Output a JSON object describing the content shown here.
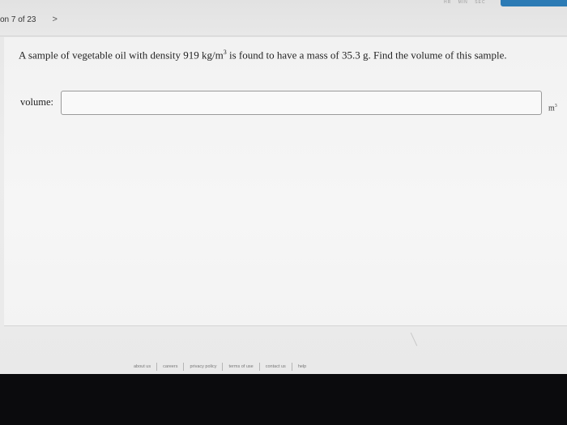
{
  "header": {
    "question_nav": "on 7 of 23",
    "next_label": ">",
    "timer_labels": [
      "HR",
      "MIN",
      "SEC"
    ]
  },
  "question": {
    "text_pre": "A sample of vegetable oil with density 919 kg/m",
    "text_sup": "3",
    "text_post": " is found to have a mass of 35.3 g. Find the volume of this sample."
  },
  "answer": {
    "label": "volume:",
    "value": "",
    "placeholder": "",
    "unit_base": "m",
    "unit_sup": "3"
  },
  "footer": {
    "links": [
      "about us",
      "careers",
      "privacy policy",
      "terms of use",
      "contact us",
      "help"
    ]
  },
  "colors": {
    "accent": "#2c7bb5"
  }
}
